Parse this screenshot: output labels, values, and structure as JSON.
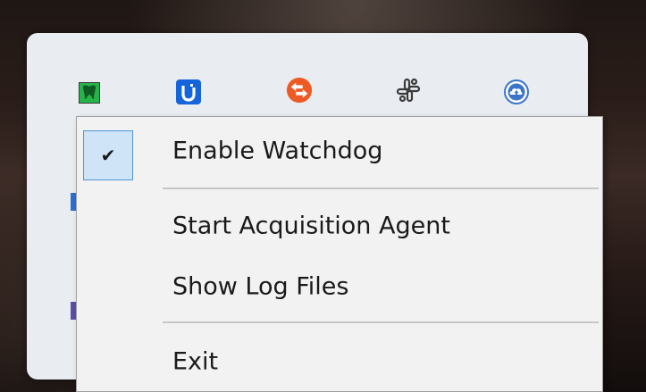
{
  "tray_icons": [
    {
      "name": "watchdog-tooth-icon",
      "color": "#26b34a"
    },
    {
      "name": "ubiquiti-icon",
      "color": "#1664d9"
    },
    {
      "name": "transfer-arrows-icon",
      "color": "#ee5a24"
    },
    {
      "name": "slack-icon",
      "color": "#4a4a4a"
    },
    {
      "name": "cloud-upload-icon",
      "color": "#3b74c9"
    }
  ],
  "context_menu": {
    "items": [
      {
        "label": "Enable Watchdog",
        "checked": true
      },
      {
        "label": "Start Acquisition Agent",
        "checked": false
      },
      {
        "label": "Show Log Files",
        "checked": false
      },
      {
        "label": "Exit",
        "checked": false
      }
    ],
    "check_mark": "✔"
  },
  "colors": {
    "menu_background": "#f2f2f2",
    "check_highlight": "#cfe4f6",
    "check_border": "#4e97d6",
    "flyout_background": "#e9ecf1"
  }
}
